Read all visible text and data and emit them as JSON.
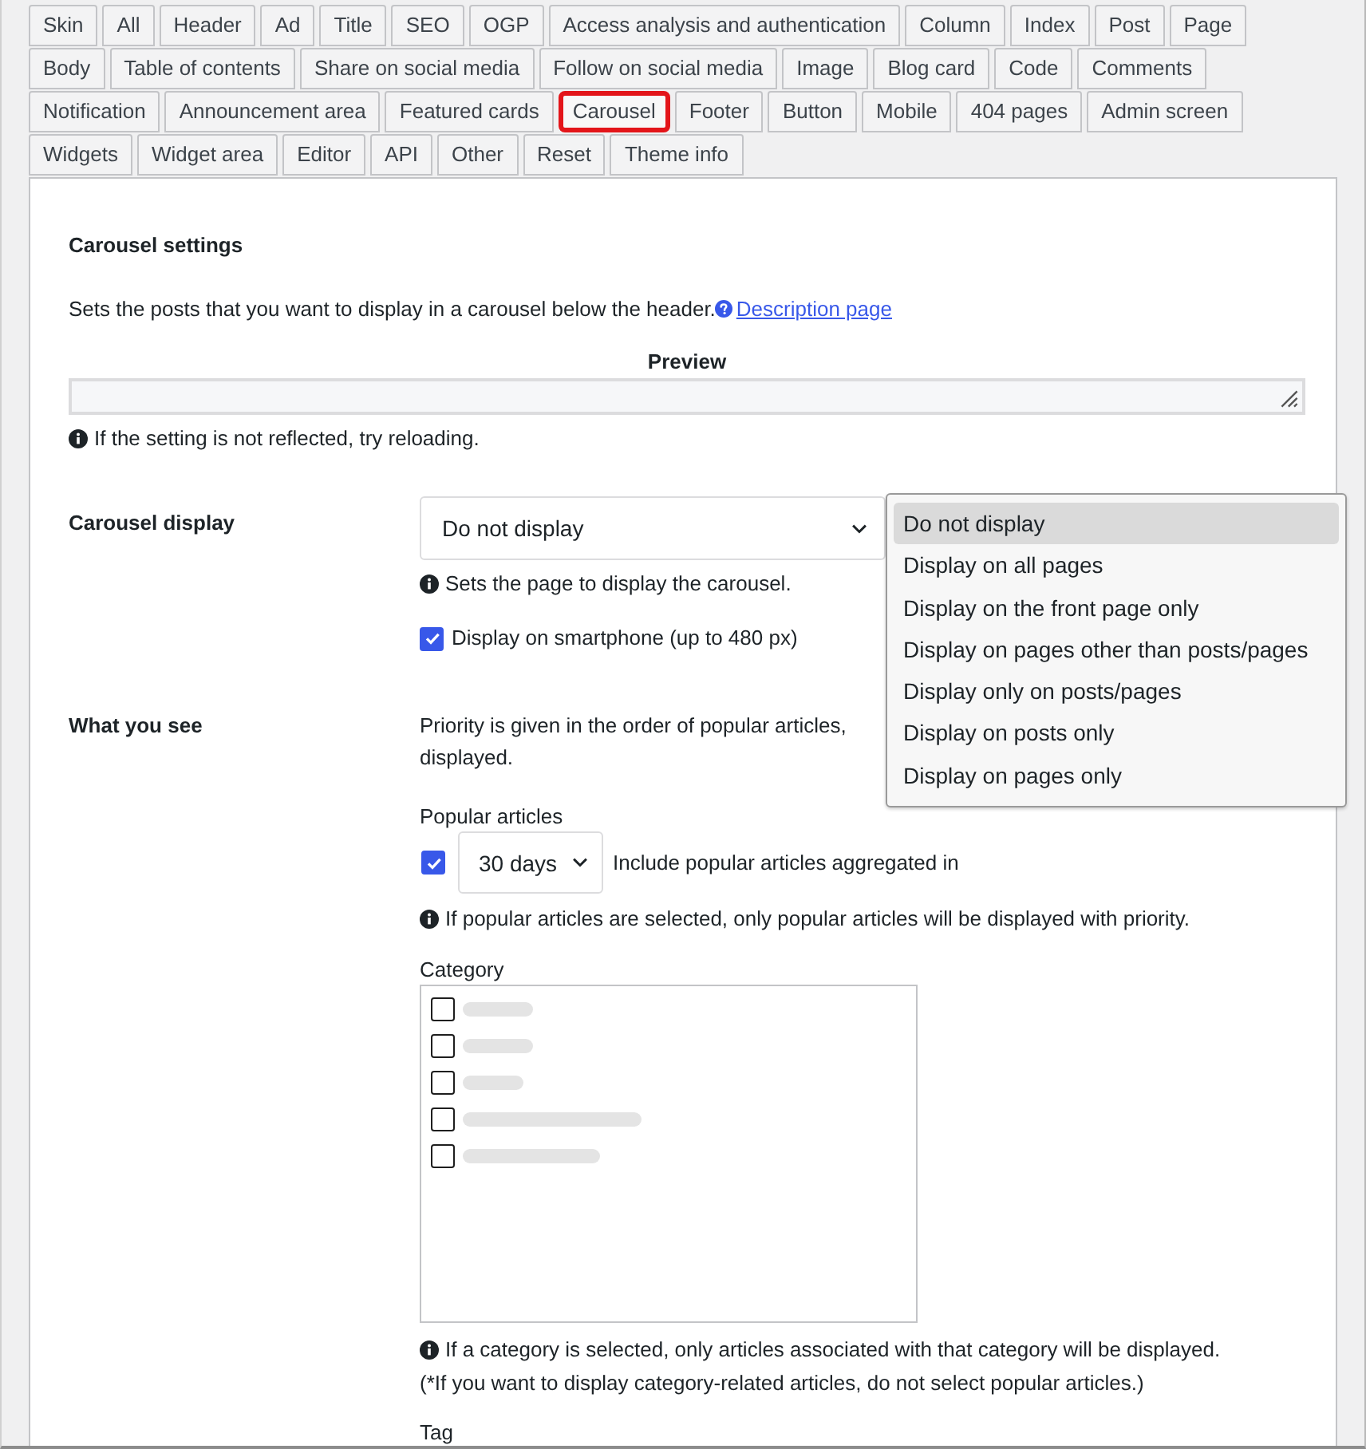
{
  "tab_rows": [
    [
      {
        "label": "Skin",
        "selected": false
      },
      {
        "label": "All",
        "selected": false
      },
      {
        "label": "Header",
        "selected": false
      },
      {
        "label": "Ad",
        "selected": false
      },
      {
        "label": "Title",
        "selected": false
      },
      {
        "label": "SEO",
        "selected": false
      },
      {
        "label": "OGP",
        "selected": false
      },
      {
        "label": "Access analysis and authentication",
        "selected": false
      },
      {
        "label": "Column",
        "selected": false
      },
      {
        "label": "Index",
        "selected": false
      },
      {
        "label": "Post",
        "selected": false
      },
      {
        "label": "Page",
        "selected": false
      }
    ],
    [
      {
        "label": "Body",
        "selected": false
      },
      {
        "label": "Table of contents",
        "selected": false
      },
      {
        "label": "Share on social media",
        "selected": false
      },
      {
        "label": "Follow on social media",
        "selected": false
      },
      {
        "label": "Image",
        "selected": false
      },
      {
        "label": "Blog card",
        "selected": false
      },
      {
        "label": "Code",
        "selected": false
      },
      {
        "label": "Comments",
        "selected": false
      }
    ],
    [
      {
        "label": "Notification",
        "selected": false
      },
      {
        "label": "Announcement area",
        "selected": false
      },
      {
        "label": "Featured cards",
        "selected": false
      },
      {
        "label": "Carousel",
        "selected": true
      },
      {
        "label": "Footer",
        "selected": false
      },
      {
        "label": "Button",
        "selected": false
      },
      {
        "label": "Mobile",
        "selected": false
      },
      {
        "label": "404 pages",
        "selected": false
      },
      {
        "label": "Admin screen",
        "selected": false
      }
    ],
    [
      {
        "label": "Widgets",
        "selected": false
      },
      {
        "label": "Widget area",
        "selected": false
      },
      {
        "label": "Editor",
        "selected": false
      },
      {
        "label": "API",
        "selected": false
      },
      {
        "label": "Other",
        "selected": false
      },
      {
        "label": "Reset",
        "selected": false
      },
      {
        "label": "Theme info",
        "selected": false
      }
    ]
  ],
  "panel": {
    "title": "Carousel settings",
    "description": "Sets the posts that you want to display in a carousel below the header.",
    "description_link": "Description page",
    "preview_label": "Preview",
    "preview_note": "If the setting is not reflected, try reloading."
  },
  "carousel_display": {
    "label": "Carousel display",
    "value": "Do not display",
    "expanded": true,
    "options": [
      {
        "label": "Do not display",
        "selected": true
      },
      {
        "label": "Display on all pages",
        "selected": false
      },
      {
        "label": "Display on the front page only",
        "selected": false
      },
      {
        "label": "Display on pages other than posts/pages",
        "selected": false
      },
      {
        "label": "Display only on posts/pages",
        "selected": false
      },
      {
        "label": "Display on posts only",
        "selected": false
      },
      {
        "label": "Display on pages only",
        "selected": false
      }
    ],
    "note": "Sets the page to display the carousel.",
    "smartphone": {
      "label": "Display on smartphone (up to 480 px)",
      "checked": true
    }
  },
  "what_you_see": {
    "label": "What you see",
    "description_lines": [
      "Priority is given in the order of popular articles,",
      "displayed."
    ],
    "popular": {
      "label": "Popular articles",
      "checked": true,
      "period": "30 days",
      "suffix": "Include popular articles aggregated in",
      "note": "If popular articles are selected, only popular articles will be displayed with priority."
    },
    "category": {
      "label": "Category",
      "items": [
        {
          "checked": false
        },
        {
          "checked": false
        },
        {
          "checked": false
        },
        {
          "checked": false
        },
        {
          "checked": false
        }
      ],
      "note": "If a category is selected, only articles associated with that category will be displayed.",
      "remark": "(*If you want to display category-related articles, do not select popular articles.)"
    },
    "tag": {
      "label": "Tag"
    }
  }
}
